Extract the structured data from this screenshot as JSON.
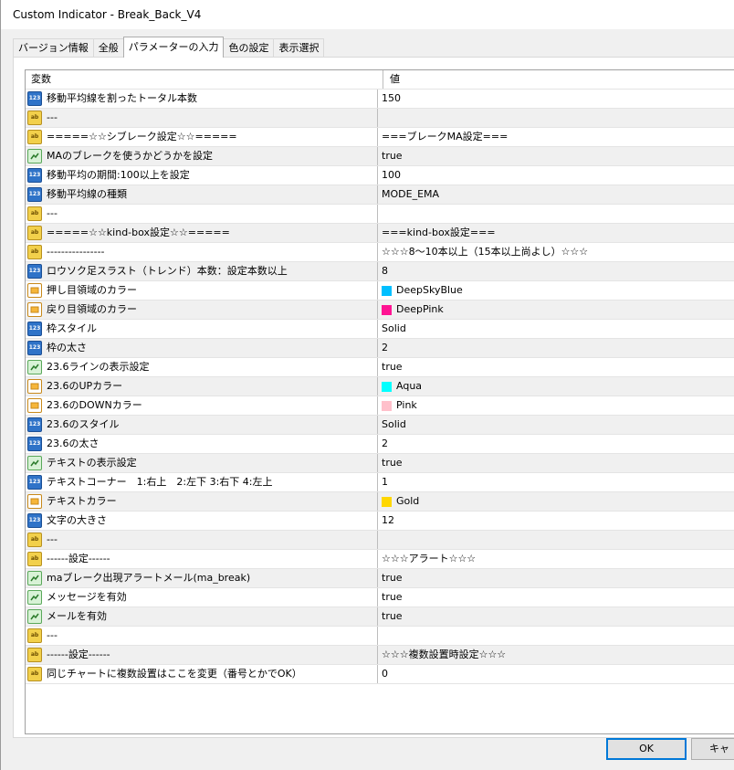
{
  "window": {
    "title": "Custom Indicator - Break_Back_V4"
  },
  "tabs": [
    {
      "label": "バージョン情報",
      "active": false
    },
    {
      "label": "全般",
      "active": false
    },
    {
      "label": "パラメーターの入力",
      "active": true
    },
    {
      "label": "色の設定",
      "active": false
    },
    {
      "label": "表示選択",
      "active": false
    }
  ],
  "grid": {
    "headers": {
      "name": "変数",
      "value": "値"
    },
    "rows": [
      {
        "icon": "int",
        "name": "移動平均線を割ったトータル本数",
        "value": "150"
      },
      {
        "icon": "str",
        "name": "---",
        "value": ""
      },
      {
        "icon": "str",
        "name": "=====☆☆シブレーク設定☆☆=====",
        "value": "===ブレークMA設定==="
      },
      {
        "icon": "bool",
        "name": "MAのブレークを使うかどうかを設定",
        "value": "true"
      },
      {
        "icon": "int",
        "name": "移動平均の期間:100以上を設定",
        "value": "100"
      },
      {
        "icon": "int",
        "name": "移動平均線の種類",
        "value": "MODE_EMA"
      },
      {
        "icon": "str",
        "name": "---",
        "value": ""
      },
      {
        "icon": "str",
        "name": "=====☆☆kind-box設定☆☆=====",
        "value": "===kind-box設定==="
      },
      {
        "icon": "str",
        "name": "----------------",
        "value": "☆☆☆8〜10本以上（15本以上尚よし）☆☆☆"
      },
      {
        "icon": "int",
        "name": "ロウソク足スラスト（トレンド）本数：設定本数以上",
        "value": "8"
      },
      {
        "icon": "color",
        "name": "押し目領域のカラー",
        "value": "DeepSkyBlue",
        "swatch": "#00bfff"
      },
      {
        "icon": "color",
        "name": "戻り目領域のカラー",
        "value": "DeepPink",
        "swatch": "#ff1493"
      },
      {
        "icon": "int",
        "name": "枠スタイル",
        "value": "Solid"
      },
      {
        "icon": "int",
        "name": "枠の太さ",
        "value": "2"
      },
      {
        "icon": "bool",
        "name": "23.6ラインの表示設定",
        "value": "true"
      },
      {
        "icon": "color",
        "name": "23.6のUPカラー",
        "value": "Aqua",
        "swatch": "#00ffff"
      },
      {
        "icon": "color",
        "name": "23.6のDOWNカラー",
        "value": "Pink",
        "swatch": "#ffc0cb"
      },
      {
        "icon": "int",
        "name": "23.6のスタイル",
        "value": "Solid"
      },
      {
        "icon": "int",
        "name": "23.6の太さ",
        "value": "2"
      },
      {
        "icon": "bool",
        "name": "テキストの表示設定",
        "value": "true"
      },
      {
        "icon": "int",
        "name": "テキストコーナー　1:右上　2:左下 3:右下 4:左上",
        "value": "1"
      },
      {
        "icon": "color",
        "name": "テキストカラー",
        "value": "Gold",
        "swatch": "#ffd700"
      },
      {
        "icon": "int",
        "name": "文字の大きさ",
        "value": "12"
      },
      {
        "icon": "str",
        "name": "---",
        "value": ""
      },
      {
        "icon": "str",
        "name": "------設定------",
        "value": "☆☆☆アラート☆☆☆"
      },
      {
        "icon": "bool",
        "name": "maブレーク出現アラートメール(ma_break)",
        "value": "true"
      },
      {
        "icon": "bool",
        "name": "メッセージを有効",
        "value": "true"
      },
      {
        "icon": "bool",
        "name": "メールを有効",
        "value": "true"
      },
      {
        "icon": "str",
        "name": "---",
        "value": ""
      },
      {
        "icon": "str",
        "name": "------設定------",
        "value": "☆☆☆複数設置時設定☆☆☆"
      },
      {
        "icon": "str",
        "name": "同じチャートに複数設置はここを変更（番号とかでOK）",
        "value": "0"
      }
    ]
  },
  "buttons": {
    "ok": "OK",
    "cancel": "キャ"
  },
  "icon_labels": {
    "int": "123",
    "str": "ab",
    "bool": "bool-check-icon",
    "color": "color-palette-icon"
  }
}
